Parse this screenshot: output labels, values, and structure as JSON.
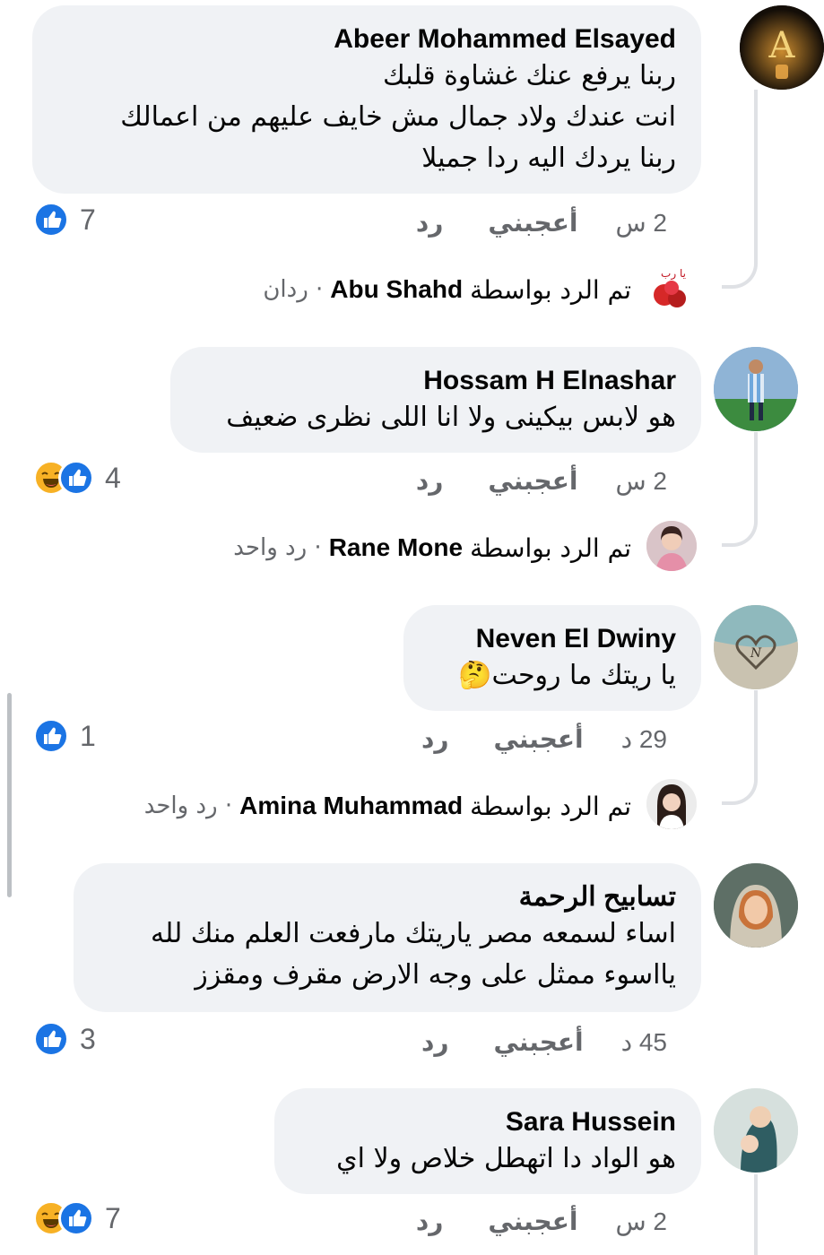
{
  "comments": [
    {
      "author": "Abeer Mohammed Elsayed",
      "lines": [
        "ربنا يرفع عنك غشاوة قلبك",
        "انت عندك ولاد جمال مش خايف عليهم من اعمالك",
        "ربنا يردك اليه ردا جميلا"
      ],
      "time": "2 س",
      "like_label": "أعجبني",
      "reply_label": "رد",
      "reaction_count": "7",
      "replies_prefix": "تم الرد بواسطة",
      "replies_name": "Abu Shahd",
      "replies_count": "· ردان"
    },
    {
      "author": "Hossam H Elnashar",
      "lines": [
        "هو لابس بيكينى ولا انا اللى نظرى ضعيف"
      ],
      "time": "2 س",
      "like_label": "أعجبني",
      "reply_label": "رد",
      "reaction_count": "4",
      "replies_prefix": "تم الرد بواسطة",
      "replies_name": "Rane Mone",
      "replies_count": "· رد واحد"
    },
    {
      "author": "Neven El Dwiny",
      "lines": [
        "يا ريتك ما روحت🤔"
      ],
      "time": "29 د",
      "like_label": "أعجبني",
      "reply_label": "رد",
      "reaction_count": "1",
      "replies_prefix": "تم الرد بواسطة",
      "replies_name": "Amina Muhammad",
      "replies_count": "· رد واحد"
    },
    {
      "author": "تسابيح الرحمة",
      "lines": [
        "اساء لسمعه مصر ياريتك مارفعت العلم منك لله",
        "يااسوء ممثل على وجه الارض مقرف ومقزز"
      ],
      "time": "45 د",
      "like_label": "أعجبني",
      "reply_label": "رد",
      "reaction_count": "3"
    },
    {
      "author": "Sara Hussein",
      "lines": [
        "هو الواد دا اتهطل خلاص ولا اي"
      ],
      "time": "2 س",
      "like_label": "أعجبني",
      "reply_label": "رد",
      "reaction_count": "7"
    }
  ],
  "colors": {
    "bubble": "#f0f2f5",
    "like_blue": "#1b74e4",
    "haha_yellow": "#f7b125",
    "meta_gray": "#65676b",
    "thread_line": "#dfe1e5"
  },
  "icons": {
    "like": "thumbs-up-icon",
    "haha": "laughing-face-icon"
  }
}
